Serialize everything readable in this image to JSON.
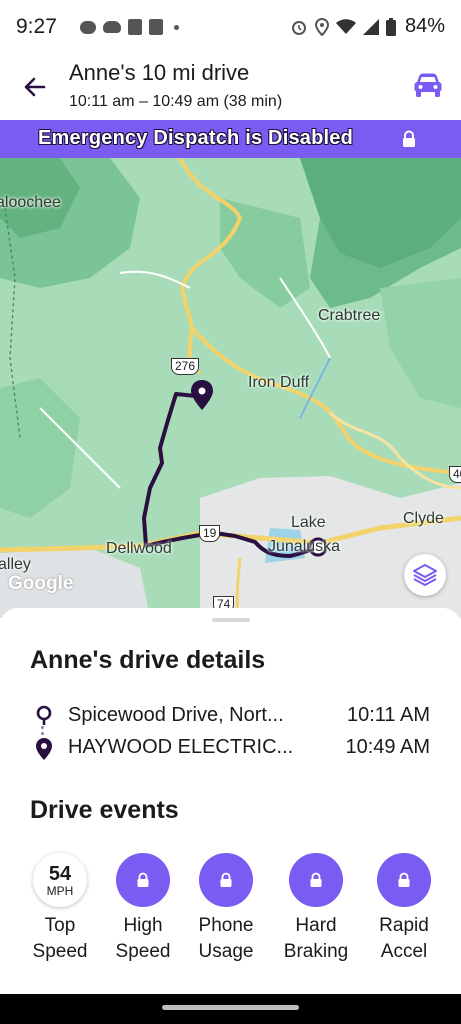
{
  "status_bar": {
    "time": "9:27",
    "battery": "84%"
  },
  "header": {
    "title": "Anne's 10 mi drive",
    "subtitle": "10:11 am – 10:49 am (38 min)"
  },
  "banner": {
    "text": "Emergency Dispatch is Disabled"
  },
  "map": {
    "labels": {
      "aloochee": "aloochee",
      "crabtree": "Crabtree",
      "iron_duff": "Iron Duff",
      "lake": "Lake",
      "junaluska": "Junaluska",
      "clyde": "Clyde",
      "dellwood": "Dellwood",
      "valley": "alley"
    },
    "shields": {
      "us276": "276",
      "us19": "19",
      "r74": "74",
      "i40": "40"
    },
    "attribution": "Google"
  },
  "details": {
    "title": "Anne's drive details",
    "start": {
      "place": "Spicewood Drive, Nort...",
      "time": "10:11 AM"
    },
    "end": {
      "place": "HAYWOOD ELECTRIC...",
      "time": "10:49 AM"
    }
  },
  "events": {
    "title": "Drive events",
    "top_speed": {
      "value": "54",
      "unit": "MPH",
      "label_1": "Top",
      "label_2": "Speed"
    },
    "items": [
      {
        "label_1": "High",
        "label_2": "Speed"
      },
      {
        "label_1": "Phone",
        "label_2": "Usage"
      },
      {
        "label_1": "Hard",
        "label_2": "Braking"
      },
      {
        "label_1": "Rapid",
        "label_2": "Accel"
      }
    ]
  },
  "colors": {
    "accent": "#7b5cf2",
    "route": "#2a1040",
    "map_green": "#a8dcb8",
    "road_yellow": "#f2d36b"
  }
}
